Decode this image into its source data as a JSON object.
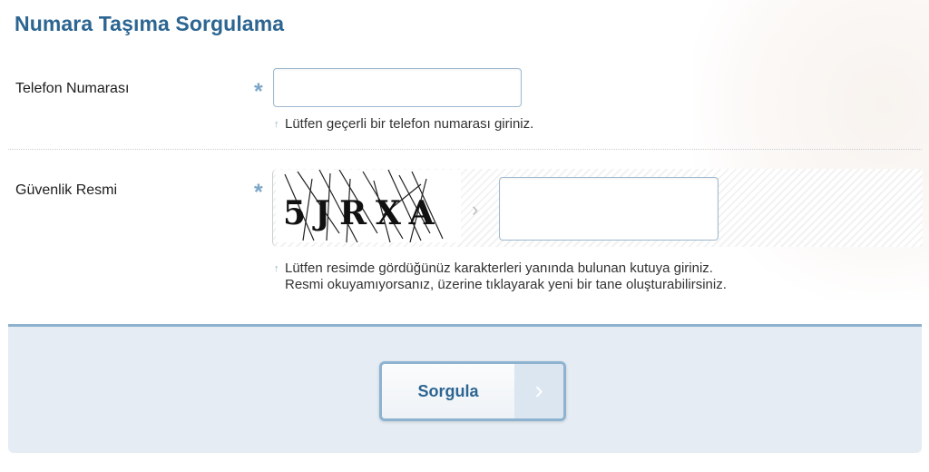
{
  "form": {
    "title": "Numara Taşıma Sorgulama",
    "phone": {
      "label": "Telefon Numarası",
      "required_mark": "*",
      "value": "",
      "hint": "Lütfen geçerli bir telefon numarası giriniz."
    },
    "captcha": {
      "label": "Güvenlik Resmi",
      "required_mark": "*",
      "image_text": "5JRXA",
      "value": "",
      "hint_line1": "Lütfen resimde gördüğünüz karakterleri yanında bulunan kutuya giriniz.",
      "hint_line2": "Resmi okuyamıyorsanız, üzerine tıklayarak yeni bir tane oluşturabilirsiniz."
    },
    "submit_label": "Sorgula"
  },
  "colors": {
    "title": "#2c6591",
    "accent": "#8eb3d1",
    "panel_bg": "#e5ecf3"
  }
}
